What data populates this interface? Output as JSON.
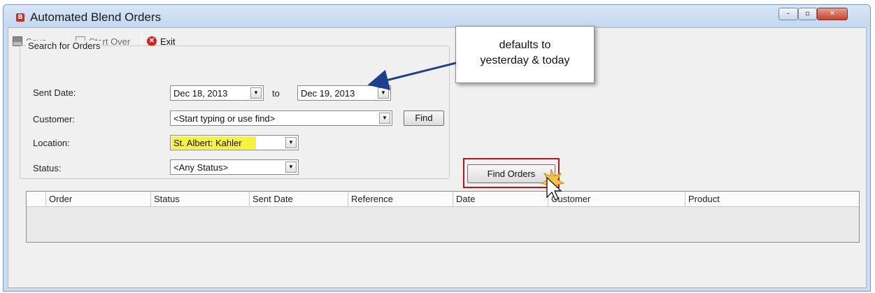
{
  "window": {
    "title": "Automated Blend Orders",
    "app_icon": "app-logo-icon",
    "controls": [
      "minimize",
      "maximize",
      "close"
    ]
  },
  "toolbar": {
    "save_label": "Save",
    "start_over_label": "Start Over",
    "exit_label": "Exit"
  },
  "search": {
    "group_title": "Search for Orders",
    "sent_date_label": "Sent Date:",
    "sent_date_from": "Dec 18, 2013",
    "to_label": "to",
    "sent_date_to": "Dec 19, 2013",
    "customer_label": "Customer:",
    "customer_value": "<Start typing or use find>",
    "find_label": "Find",
    "location_label": "Location:",
    "location_value": "St. Albert: Kahler",
    "status_label": "Status:",
    "status_value": "<Any Status>",
    "find_orders_label": "Find Orders"
  },
  "grid": {
    "columns": [
      "Order",
      "Status",
      "Sent Date",
      "Reference",
      "Date",
      "Customer",
      "Product"
    ]
  },
  "callout": {
    "line1": "defaults to",
    "line2": "yesterday & today"
  },
  "colors": {
    "accent_red": "#b8141c",
    "highlight": "#f5f33a",
    "arrow": "#1f3f8f"
  }
}
